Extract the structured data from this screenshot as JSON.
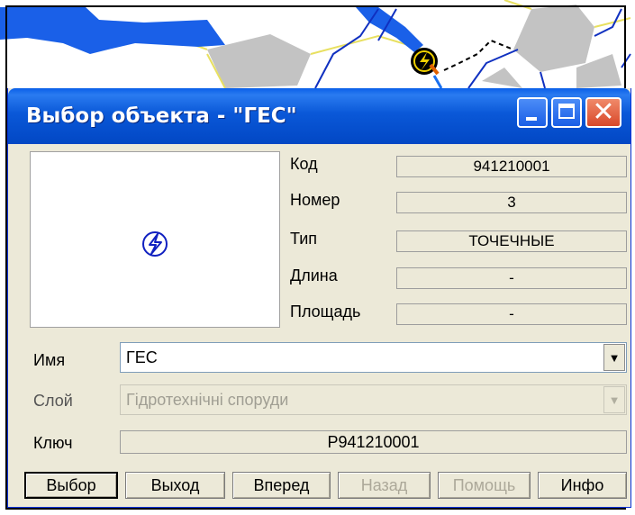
{
  "window": {
    "title": "Выбор объекта - \"ГЕС\"",
    "minimize_icon": "minimize-icon",
    "maximize_icon": "maximize-icon",
    "close_icon": "close-icon",
    "close_glyph": "✕"
  },
  "preview": {
    "icon": "hydro-plant-icon"
  },
  "properties": [
    {
      "label": "Код",
      "value": "941210001"
    },
    {
      "label": "Номер",
      "value": "3"
    },
    {
      "label": "Тип",
      "value": "ТОЧЕЧНЫЕ"
    },
    {
      "label": "Длина",
      "value": "-"
    },
    {
      "label": "Площадь",
      "value": "-"
    }
  ],
  "form": {
    "name_label": "Имя",
    "name_value": "ГЕС",
    "layer_label": "Слой",
    "layer_value": "Гідротехнічні споруди",
    "key_label": "Ключ",
    "key_value": "Р941210001",
    "dropdown_arrow": "▼"
  },
  "buttons": {
    "select": "Выбор",
    "exit": "Выход",
    "forward": "Вперед",
    "back": "Назад",
    "help": "Помощь",
    "info": "Инфо"
  },
  "map": {
    "water_color": "#1a60e8",
    "land_color": "#c3c3c3",
    "road_color": "#e8e060",
    "river_color": "#1030c0"
  }
}
